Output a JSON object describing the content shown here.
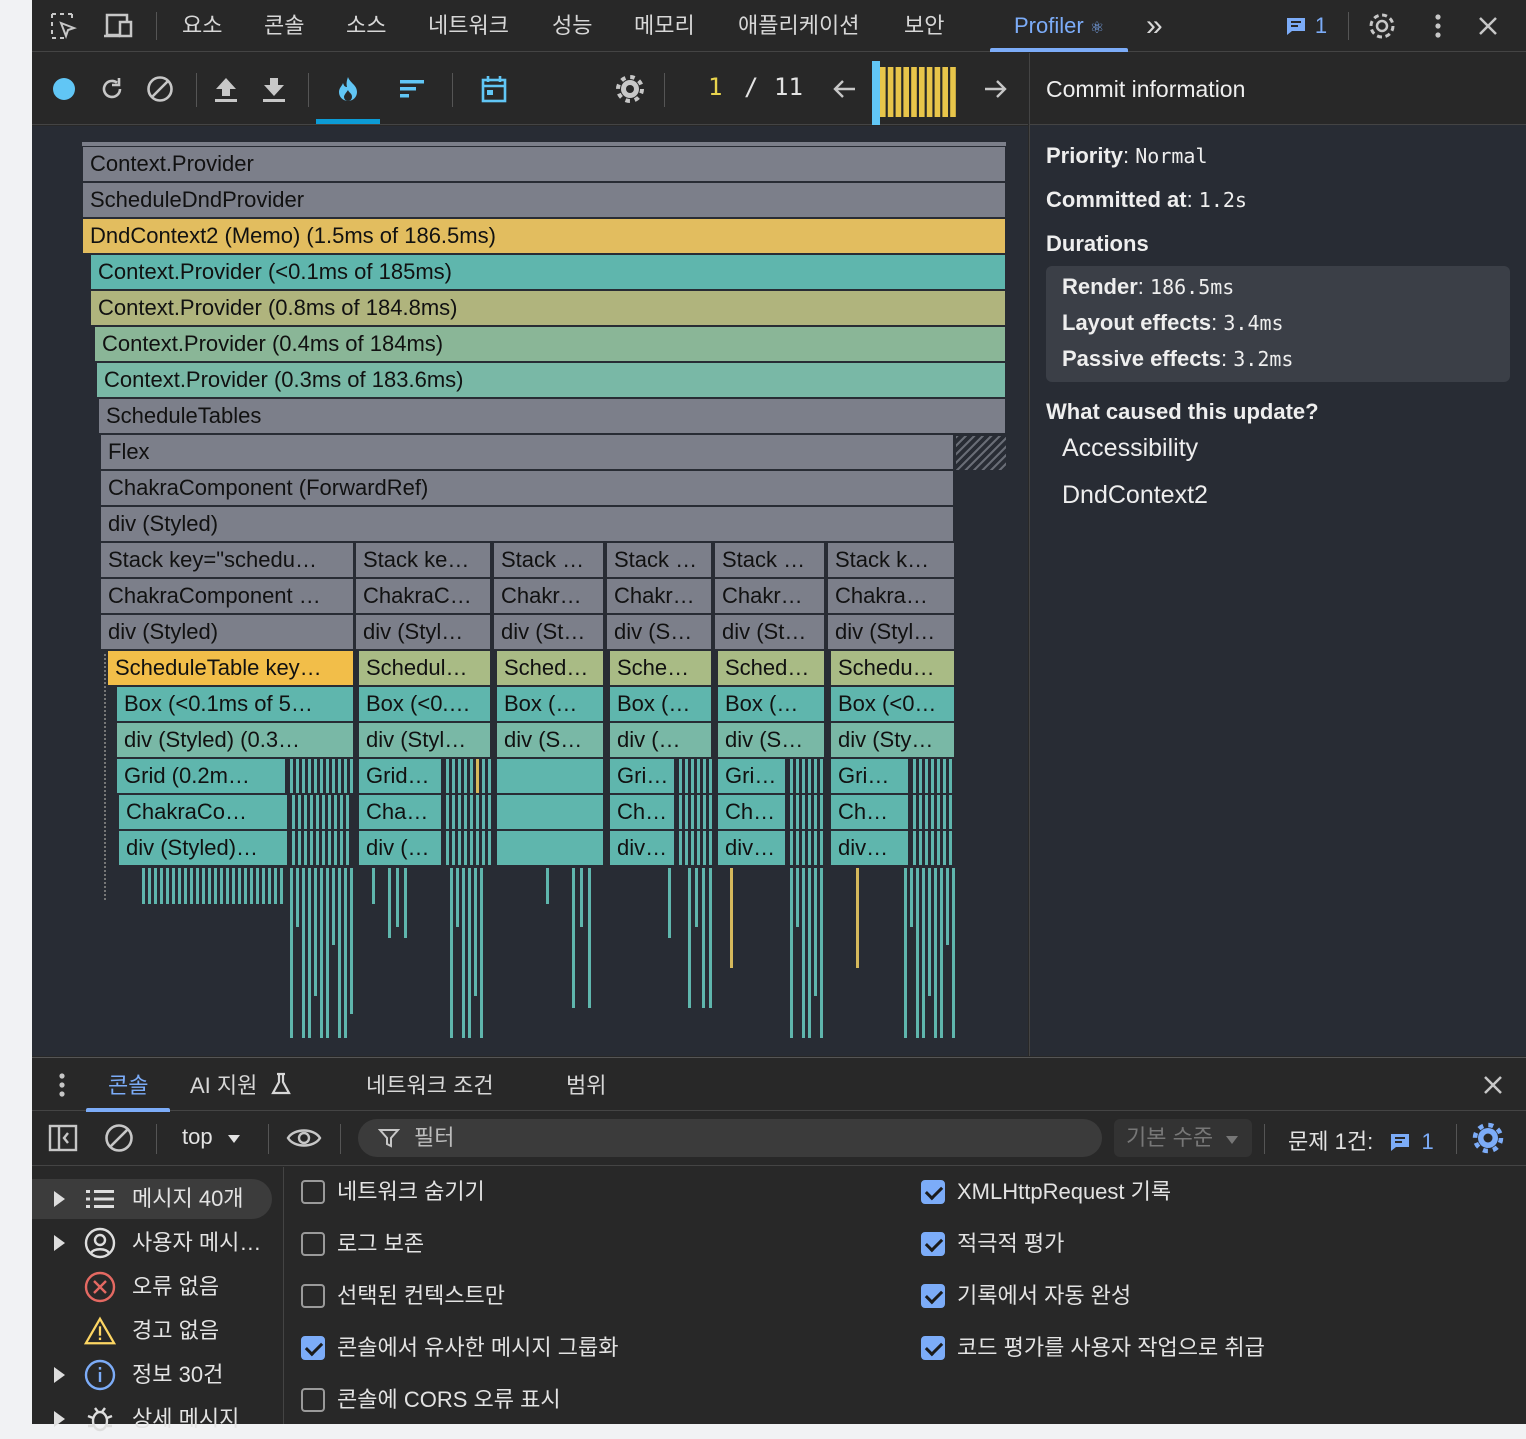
{
  "tabs": {
    "elements": "요소",
    "console": "콘솔",
    "sources": "소스",
    "network": "네트워크",
    "performance": "성능",
    "memory": "메모리",
    "application": "애플리케이션",
    "security": "보안",
    "profiler": "Profiler",
    "profiler_icon": "⚛",
    "more": "»",
    "issues_count": "1"
  },
  "profiler": {
    "commit_current": "1",
    "commit_sep": "/",
    "commit_total": "11",
    "commit_bars": 11,
    "flame": {
      "full_rows": [
        {
          "label": "Context.Provider",
          "color": "gray"
        },
        {
          "label": "ScheduleDndProvider",
          "color": "gray"
        },
        {
          "label": "DndContext2 (Memo) (1.5ms of 186.5ms)",
          "color": "yellow"
        },
        {
          "label": "Context.Provider (<0.1ms of 185ms)",
          "color": "teal"
        },
        {
          "label": "Context.Provider (0.8ms of 184.8ms)",
          "color": "olive"
        },
        {
          "label": "Context.Provider (0.4ms of 184ms)",
          "color": "mint"
        },
        {
          "label": "Context.Provider (0.3ms of 183.6ms)",
          "color": "greenteal"
        },
        {
          "label": "ScheduleTables",
          "color": "gray"
        },
        {
          "label": "Flex",
          "color": "gray"
        },
        {
          "label": "ChakraComponent (ForwardRef)",
          "color": "gray"
        },
        {
          "label": "div (Styled)",
          "color": "gray"
        }
      ],
      "columns": [
        [
          "Stack key=\"schedu…",
          "ChakraComponent …",
          "div (Styled)",
          "ScheduleTable key…",
          "Box (<0.1ms of 5…",
          "div (Styled) (0.3…",
          "Grid (0.2m…",
          "ChakraCo…",
          "div (Styled)…"
        ],
        [
          "Stack ke…",
          "ChakraC…",
          "div (Styl…",
          "Schedul…",
          "Box (<0.…",
          "div (Styl…",
          "Grid…",
          "Cha…",
          "div (…"
        ],
        [
          "Stack …",
          "Chakr…",
          "div (St…",
          "Sched…",
          "Box (…",
          "div (S…",
          "",
          "",
          ""
        ],
        [
          "Stack …",
          "Chakr…",
          "div (S…",
          "Sche…",
          "Box (…",
          "div (…",
          "Gri…",
          "Ch…",
          "div…"
        ],
        [
          "Stack …",
          "Chakr…",
          "div (St…",
          "Sched…",
          "Box (…",
          "div (S…",
          "Gri…",
          "Ch…",
          "div…"
        ],
        [
          "Stack k…",
          "Chakra…",
          "div (Styl…",
          "Schedu…",
          "Box (<0…",
          "div (Sty…",
          "Gri…",
          "Ch…",
          "div…"
        ]
      ]
    }
  },
  "commit_info": {
    "title": "Commit information",
    "priority_label": "Priority",
    "priority_value": "Normal",
    "committed_label": "Committed at",
    "committed_value": "1.2s",
    "durations_label": "Durations",
    "render_label": "Render",
    "render_value": "186.5ms",
    "layout_label": "Layout effects",
    "layout_value": "3.4ms",
    "passive_label": "Passive effects",
    "passive_value": "3.2ms",
    "cause_label": "What caused this update?",
    "causes": [
      "Accessibility",
      "DndContext2"
    ]
  },
  "drawer": {
    "tabs": {
      "console": "콘솔",
      "ai": "AI 지원",
      "network_conditions": "네트워크 조건",
      "coverage": "범위"
    },
    "toolbar": {
      "context": "top",
      "filter_placeholder": "필터",
      "levels": "기본 수준",
      "issues_label": "문제 1건:",
      "issues_count": "1"
    },
    "sidebar": [
      {
        "label": "메시지 40개",
        "icon": "list-icon",
        "arrow": true
      },
      {
        "label": "사용자 메시…",
        "icon": "user-icon",
        "arrow": true
      },
      {
        "label": "오류 없음",
        "icon": "error-icon",
        "arrow": false
      },
      {
        "label": "경고 없음",
        "icon": "warning-icon",
        "arrow": false
      },
      {
        "label": "정보 30건",
        "icon": "info-icon",
        "arrow": true
      },
      {
        "label": "상세 메시지",
        "icon": "bug-icon",
        "arrow": true
      }
    ],
    "settings_left": [
      {
        "label": "네트워크 숨기기",
        "checked": false
      },
      {
        "label": "로그 보존",
        "checked": false
      },
      {
        "label": "선택된 컨텍스트만",
        "checked": false
      },
      {
        "label": "콘솔에서 유사한 메시지 그룹화",
        "checked": true
      },
      {
        "label": "콘솔에 CORS 오류 표시",
        "checked": false
      }
    ],
    "settings_right": [
      {
        "label": "XMLHttpRequest 기록",
        "checked": true
      },
      {
        "label": "적극적 평가",
        "checked": true
      },
      {
        "label": "기록에서 자동 완성",
        "checked": true
      },
      {
        "label": "코드 평가를 사용자 작업으로 취급",
        "checked": true
      }
    ]
  },
  "colors": {
    "accent": "#7cacf8",
    "react_blue": "#0c9bd5",
    "flame_gray": "#7c7f8a",
    "flame_yellow": "#e2bd5f",
    "flame_teal": "#5fb6ad",
    "commit_bar": "#e8c54a"
  }
}
